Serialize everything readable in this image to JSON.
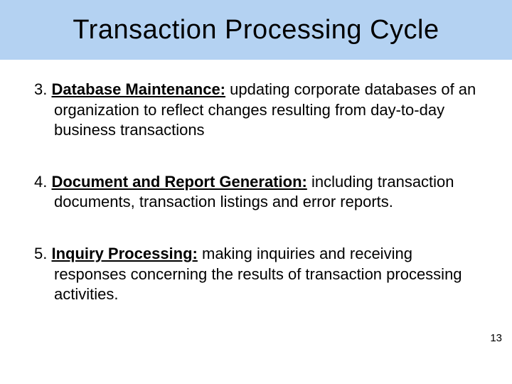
{
  "title": "Transaction Processing Cycle",
  "items": [
    {
      "num": "3.",
      "heading": "Database Maintenance:",
      "body": " updating corporate databases of an organization to reflect changes resulting from day-to-day business transactions"
    },
    {
      "num": "4.",
      "heading": "Document and Report Generation:",
      "body": " including transaction documents, transaction listings and error reports."
    },
    {
      "num": "5.",
      "heading": "Inquiry Processing:",
      "body": " making inquiries and receiving responses concerning the results of transaction processing activities."
    }
  ],
  "page_number": "13"
}
